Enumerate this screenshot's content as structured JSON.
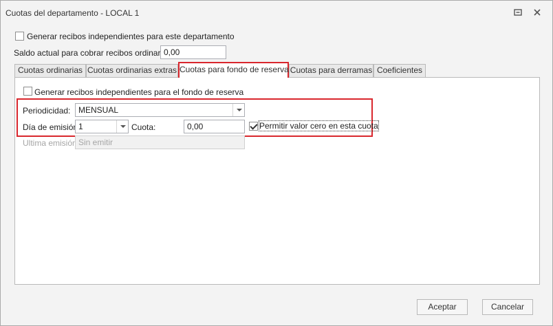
{
  "window": {
    "title": "Cuotas del departamento - LOCAL 1"
  },
  "general": {
    "independent_receipts_label": "Generar recibos independientes para este departamento",
    "independent_receipts_checked": false,
    "balance_label": "Saldo actual para cobrar recibos ordinarios:",
    "balance_value": "0,00"
  },
  "tabs": [
    {
      "label": "Cuotas ordinarias",
      "active": false
    },
    {
      "label": "Cuotas ordinarias extras",
      "active": false
    },
    {
      "label": "Cuotas para fondo de reserva",
      "active": true
    },
    {
      "label": "Cuotas para derramas",
      "active": false
    },
    {
      "label": "Coeficientes",
      "active": false
    }
  ],
  "reserve": {
    "independent_label": "Generar recibos independientes para el fondo de reserva",
    "independent_checked": false,
    "periodicity_label": "Periodicidad:",
    "periodicity_value": "MENSUAL",
    "emission_day_label": "Día de emisión:",
    "emission_day_value": "1",
    "fee_label": "Cuota:",
    "fee_value": "0,00",
    "allow_zero_label": "Permitir valor cero en esta cuota",
    "allow_zero_checked": true,
    "last_emission_label": "Ultima emisión:",
    "last_emission_value": "Sin emitir"
  },
  "footer": {
    "accept_label": "Aceptar",
    "cancel_label": "Cancelar"
  },
  "colors": {
    "highlight": "#d9262c",
    "window_bg": "#f3f3f3"
  },
  "icons": {
    "restore": "restore-icon",
    "close": "close-icon"
  }
}
